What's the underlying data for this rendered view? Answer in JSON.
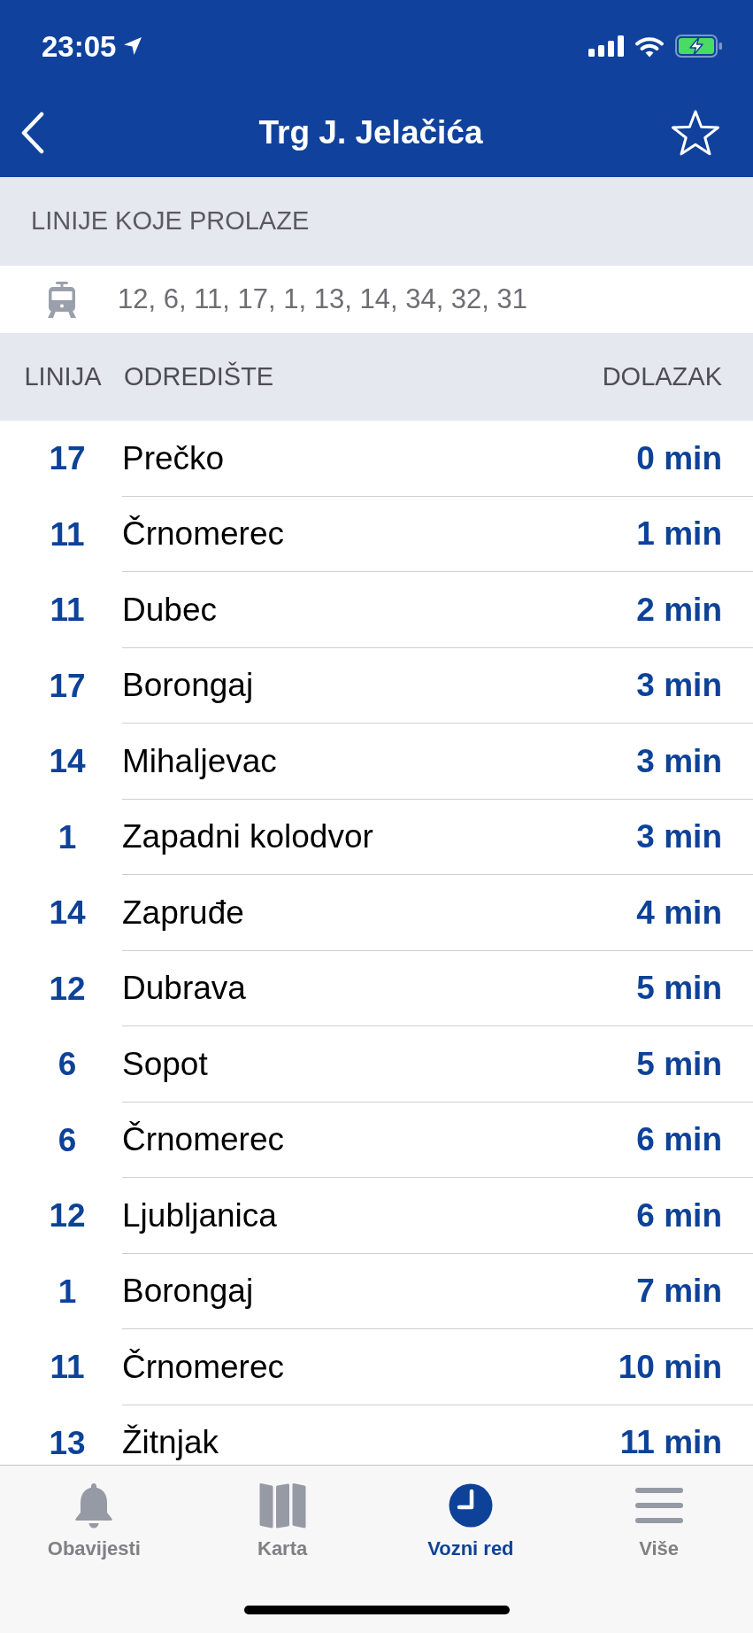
{
  "status_bar": {
    "time": "23:05"
  },
  "header": {
    "title": "Trg J. Jelačića",
    "favorite": false
  },
  "lines_section": {
    "title": "LINIJE KOJE PROLAZE",
    "lines": "12, 6, 11, 17, 1, 13, 14, 34, 32, 31"
  },
  "table": {
    "columns": [
      "LINIJA",
      "ODREDIŠTE",
      "DOLAZAK"
    ],
    "rows": [
      {
        "line": "17",
        "destination": "Prečko",
        "arrival": "0 min"
      },
      {
        "line": "11",
        "destination": "Črnomerec",
        "arrival": "1 min"
      },
      {
        "line": "11",
        "destination": "Dubec",
        "arrival": "2 min"
      },
      {
        "line": "17",
        "destination": "Borongaj",
        "arrival": "3 min"
      },
      {
        "line": "14",
        "destination": "Mihaljevac",
        "arrival": "3 min"
      },
      {
        "line": "1",
        "destination": "Zapadni kolodvor",
        "arrival": "3 min"
      },
      {
        "line": "14",
        "destination": "Zapruđe",
        "arrival": "4 min"
      },
      {
        "line": "12",
        "destination": "Dubrava",
        "arrival": "5 min"
      },
      {
        "line": "6",
        "destination": "Sopot",
        "arrival": "5 min"
      },
      {
        "line": "6",
        "destination": "Črnomerec",
        "arrival": "6 min"
      },
      {
        "line": "12",
        "destination": "Ljubljanica",
        "arrival": "6 min"
      },
      {
        "line": "1",
        "destination": "Borongaj",
        "arrival": "7 min"
      },
      {
        "line": "11",
        "destination": "Črnomerec",
        "arrival": "10 min"
      },
      {
        "line": "13",
        "destination": "Žitnjak",
        "arrival": "11 min"
      }
    ]
  },
  "tab_bar": {
    "tabs": [
      {
        "label": "Obavijesti",
        "selected": false
      },
      {
        "label": "Karta",
        "selected": false
      },
      {
        "label": "Vozni red",
        "selected": true
      },
      {
        "label": "Više",
        "selected": false
      }
    ]
  }
}
